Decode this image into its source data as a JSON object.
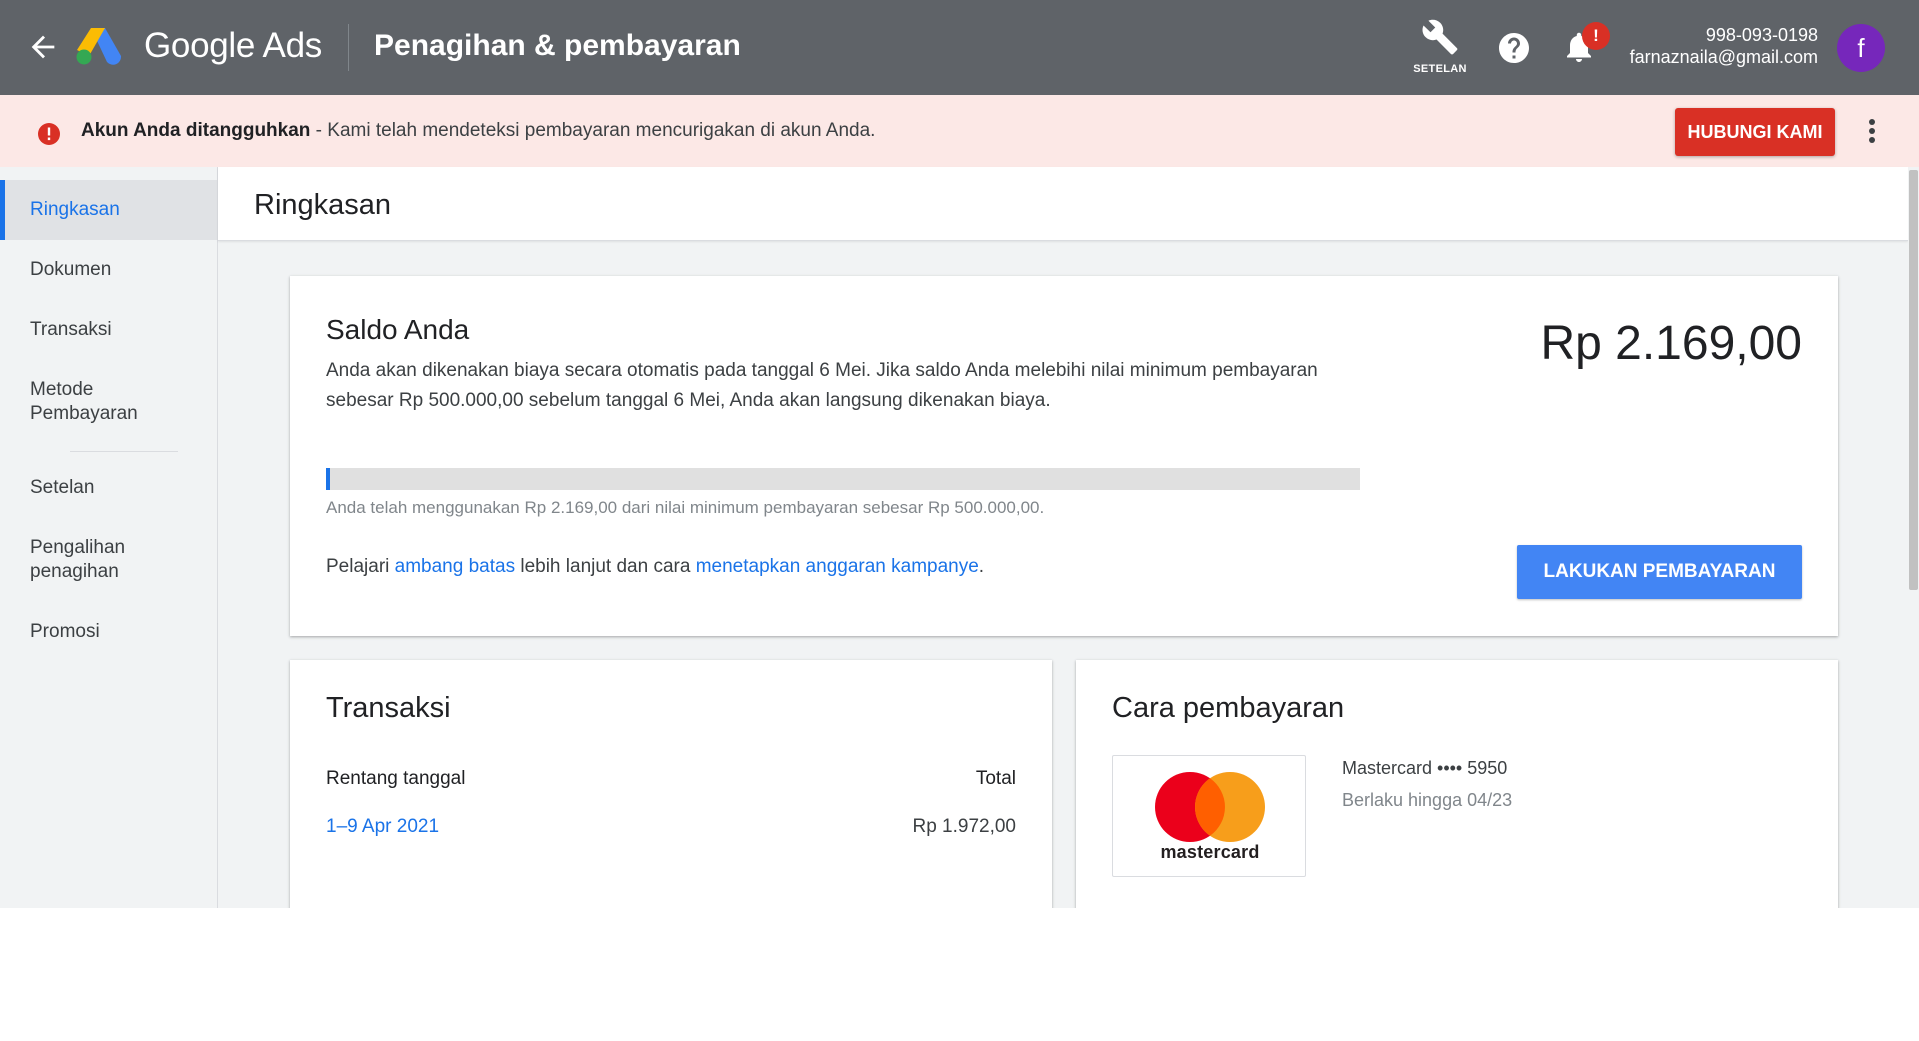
{
  "header": {
    "brand": "Google Ads",
    "page_title": "Penagihan & pembayaran",
    "settings_label": "SETELAN",
    "notification_badge": "!",
    "customer_id": "998-093-0198",
    "email": "farnaznaila@gmail.com",
    "avatar_initial": "f"
  },
  "alert": {
    "title": "Akun Anda ditangguhkan",
    "message": " - Kami telah mendeteksi pembayaran mencurigakan di akun Anda.",
    "button": "HUBUNGI KAMI"
  },
  "sidebar": {
    "items": [
      {
        "label": "Ringkasan"
      },
      {
        "label": "Dokumen"
      },
      {
        "label": "Transaksi"
      },
      {
        "label": "Metode Pembayaran"
      },
      {
        "label": "Setelan"
      },
      {
        "label": "Pengalihan penagihan"
      },
      {
        "label": "Promosi"
      }
    ]
  },
  "main": {
    "title": "Ringkasan",
    "balance": {
      "title": "Saldo Anda",
      "description": "Anda akan dikenakan biaya secara otomatis pada tanggal 6 Mei. Jika saldo Anda melebihi nilai minimum pembayaran sebesar Rp 500.000,00 sebelum tanggal 6 Mei, Anda akan langsung dikenakan biaya.",
      "amount": "Rp 2.169,00",
      "progress_fraction": 0.0043,
      "usage_note": "Anda telah menggunakan Rp 2.169,00 dari nilai minimum pembayaran sebesar Rp 500.000,00.",
      "learn_prefix": "Pelajari ",
      "learn_link1": "ambang batas",
      "learn_mid": " lebih lanjut dan cara ",
      "learn_link2": "menetapkan anggaran kampanye",
      "learn_suffix": ".",
      "pay_button": "LAKUKAN PEMBAYARAN"
    },
    "transactions": {
      "title": "Transaksi",
      "col_range": "Rentang tanggal",
      "col_total": "Total",
      "rows": [
        {
          "range": "1–9 Apr 2021",
          "total": "Rp 1.972,00"
        }
      ]
    },
    "payment_method": {
      "title": "Cara pembayaran",
      "logo_text": "mastercard",
      "card_name": "Mastercard •••• 5950",
      "valid_until": "Berlaku hingga 04/23"
    }
  },
  "colors": {
    "header_bg": "#5f6368",
    "alert_bg": "#fce8e6",
    "danger": "#d93025",
    "accent": "#1a73e8",
    "pay_button": "#4285f4",
    "avatar": "#7627bb"
  },
  "icons": [
    "arrow-back-icon",
    "google-ads-logo-icon",
    "wrench-icon",
    "help-icon",
    "bell-icon",
    "error-icon",
    "more-vert-icon",
    "mastercard-logo-icon"
  ]
}
